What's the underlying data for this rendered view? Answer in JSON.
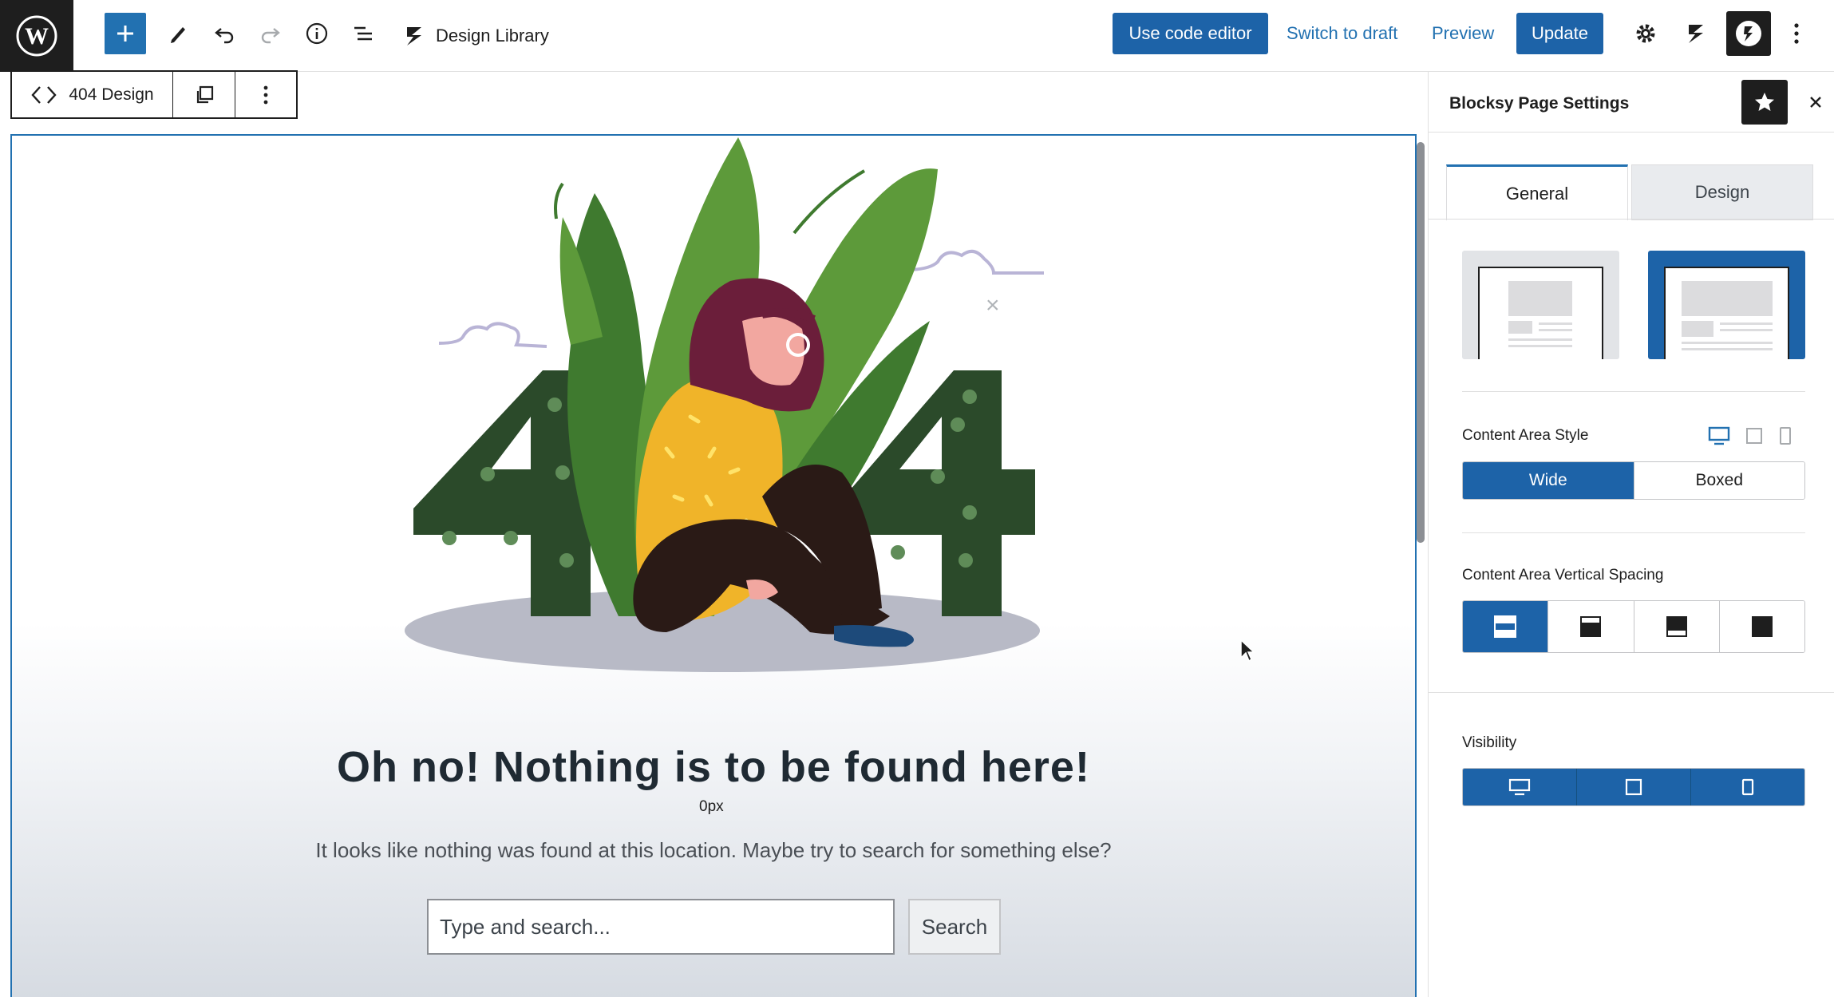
{
  "toolbar": {
    "document_title": "Design Library",
    "code_editor_label": "Use code editor",
    "switch_draft_label": "Switch to draft",
    "preview_label": "Preview",
    "update_label": "Update"
  },
  "block_toolbar": {
    "block_label": "404 Design"
  },
  "canvas": {
    "spacer_label": "0px",
    "heading": "Oh no! Nothing is to be found here!",
    "subtext": "It looks like nothing was found at this location. Maybe try to search for something else?",
    "search_placeholder": "Type and search...",
    "search_button": "Search"
  },
  "sidebar": {
    "title": "Blocksy Page Settings",
    "tabs": [
      {
        "label": "General",
        "active": true
      },
      {
        "label": "Design",
        "active": false
      }
    ],
    "content_area_style": {
      "label": "Content Area Style",
      "options": [
        "Wide",
        "Boxed"
      ],
      "selected": "Wide"
    },
    "vertical_spacing": {
      "label": "Content Area Vertical Spacing"
    },
    "visibility": {
      "label": "Visibility"
    }
  },
  "colors": {
    "accent": "#1d63a8",
    "illustration_dark_green": "#2b4a2a",
    "illustration_leaf_green": "#5d9a3a",
    "illustration_yellow": "#f0b429"
  }
}
